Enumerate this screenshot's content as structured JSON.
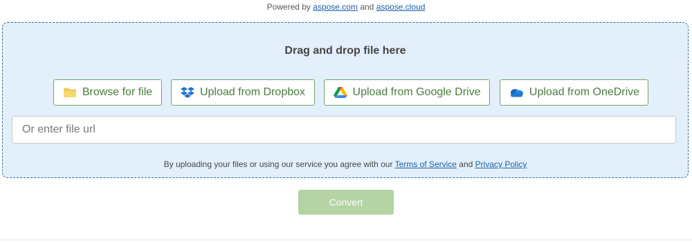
{
  "powered": {
    "prefix": "Powered by",
    "link1": "aspose.com",
    "middle": "and",
    "link2": "aspose.cloud"
  },
  "dropzone": {
    "title": "Drag and drop file here",
    "buttons": {
      "browse": "Browse for file",
      "dropbox": "Upload from Dropbox",
      "gdrive": "Upload from Google Drive",
      "onedrive": "Upload from OneDrive"
    },
    "url_placeholder": "Or enter file url",
    "url_value": ""
  },
  "terms": {
    "prefix": "By uploading your files or using our service you agree with our",
    "terms_link": "Terms of Service",
    "middle": "and",
    "privacy_link": "Privacy Policy"
  },
  "convert": {
    "label": "Convert"
  },
  "icons": {
    "browse": "folder-icon",
    "dropbox": "dropbox-icon",
    "gdrive": "google-drive-icon",
    "onedrive": "onedrive-icon"
  },
  "colors": {
    "accent_green": "#4a7a3e",
    "button_border": "#6ea468",
    "convert_disabled": "#b5d3a4",
    "dropzone_bg": "#e3f0fb",
    "link": "#1a5fa8"
  }
}
